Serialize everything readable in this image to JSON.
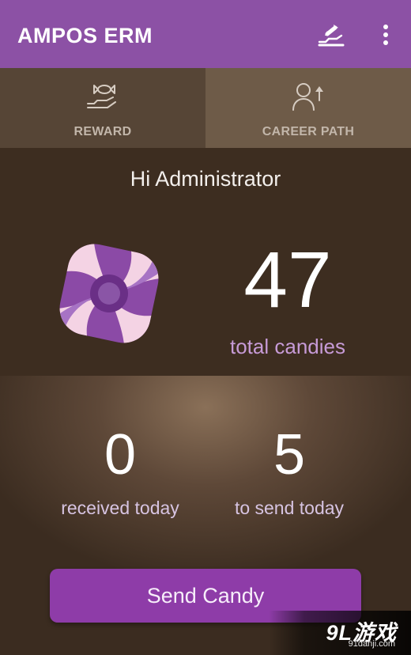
{
  "appbar": {
    "title": "AMPOS ERM",
    "candy_icon": "candy-hand-icon",
    "menu_icon": "more-vert-icon"
  },
  "tabs": [
    {
      "label": "REWARD",
      "icon": "candy-hand-icon"
    },
    {
      "label": "CAREER PATH",
      "icon": "person-up-icon"
    }
  ],
  "summary": {
    "greeting": "Hi Administrator",
    "total_count": "47",
    "total_label": "total candies"
  },
  "today": {
    "received_count": "0",
    "received_label": "received today",
    "send_count": "5",
    "send_label": "to send today"
  },
  "actions": {
    "send_label": "Send Candy"
  },
  "watermark": {
    "brand": "9L游戏",
    "domain": "91danji.com"
  },
  "colors": {
    "appbar": "#8c51a5",
    "accent_text": "#c79bd7",
    "button": "#8e3ca8",
    "background": "#3d2d20"
  }
}
